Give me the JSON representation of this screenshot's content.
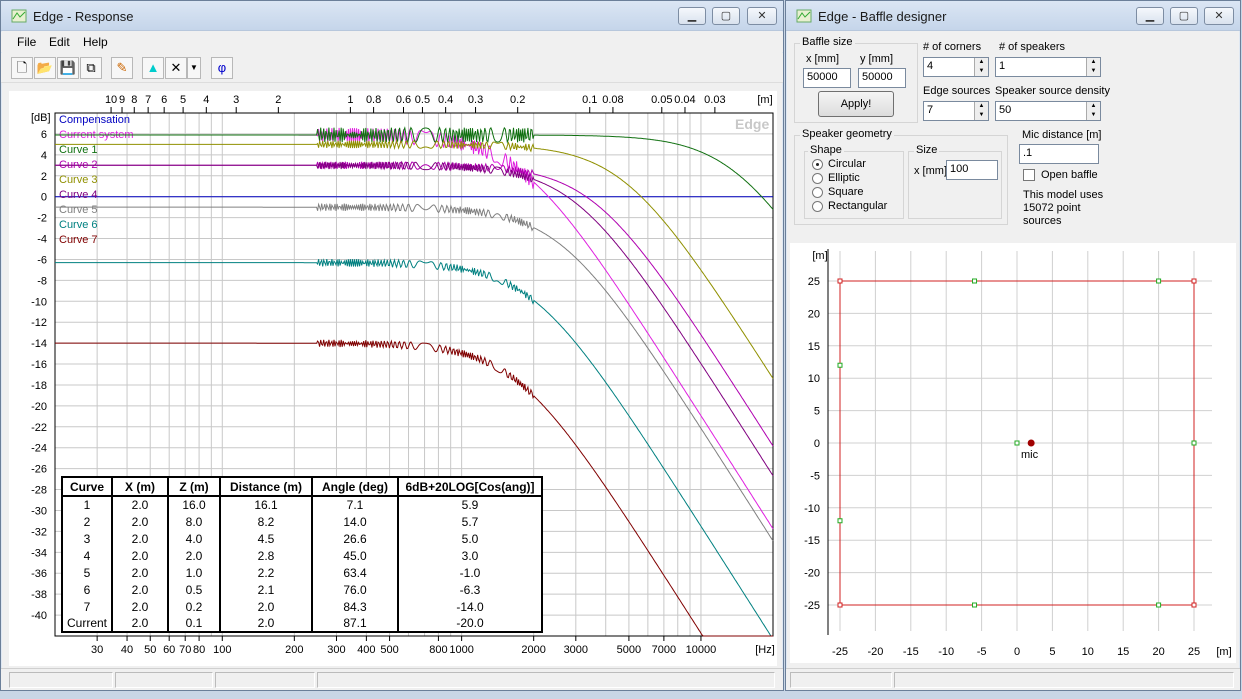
{
  "response_window": {
    "title": "Edge - Response",
    "menu": [
      "File",
      "Edit",
      "Help"
    ],
    "toolbar_icons": [
      "new-file-icon",
      "open-folder-icon",
      "save-icon",
      "copy-icon",
      "pen-icon",
      "bell-icon",
      "delete-x-icon",
      "dropdown-arrow-icon",
      "phi-icon"
    ],
    "phi_label": "φ",
    "watermark": "Edge",
    "chart_data": {
      "type": "line",
      "x_scale": "log",
      "x_unit": "[Hz]",
      "x_ticks": [
        "30",
        "40",
        "50",
        "60",
        "70",
        "80",
        "100",
        "200",
        "300",
        "400",
        "500",
        "800",
        "1000",
        "2000",
        "3000",
        "5000",
        "7000",
        "10000"
      ],
      "xlim": [
        20,
        20000
      ],
      "top_unit": "[m]",
      "top_ticks": [
        "10",
        "9",
        "8",
        "7",
        "6",
        "5",
        "4",
        "3",
        "2",
        "1",
        "0.8",
        "0.6",
        "0.5",
        "0.4",
        "0.3",
        "0.2",
        "0.1",
        "0.08",
        "0.05",
        "0.04",
        "0.03"
      ],
      "y_unit": "[dB]",
      "ylim": [
        -42,
        8
      ],
      "y_ticks": [
        6,
        4,
        2,
        0,
        -2,
        -4,
        -6,
        -8,
        -10,
        -12,
        -14,
        -16,
        -18,
        -20,
        -22,
        -24,
        -26,
        -28,
        -30,
        -32,
        -34,
        -36,
        -38,
        -40
      ],
      "grid": true,
      "legend_position": "top-left",
      "series": [
        {
          "name": "Compensation",
          "color": "#0000c0",
          "level_db": 0.0
        },
        {
          "name": "Current system",
          "color": "#e020e0",
          "level_db": 5.9
        },
        {
          "name": "Curve 1",
          "color": "#107010",
          "level_db": 5.9
        },
        {
          "name": "Curve 2",
          "color": "#b000b0",
          "level_db": 3.0
        },
        {
          "name": "Curve 3",
          "color": "#909000",
          "level_db": 5.0
        },
        {
          "name": "Curve 4",
          "color": "#800080",
          "level_db": 3.0
        },
        {
          "name": "Curve 5",
          "color": "#808080",
          "level_db": -1.0
        },
        {
          "name": "Curve 6",
          "color": "#008080",
          "level_db": -6.3
        },
        {
          "name": "Curve 7",
          "color": "#800000",
          "level_db": -14.0
        }
      ]
    },
    "table": {
      "headers": [
        "Curve",
        "X (m)",
        "Z (m)",
        "Distance (m)",
        "Angle (deg)",
        "6dB+20LOG[Cos(ang)]"
      ],
      "rows": [
        [
          "1",
          "2.0",
          "16.0",
          "16.1",
          "7.1",
          "5.9"
        ],
        [
          "2",
          "2.0",
          "8.0",
          "8.2",
          "14.0",
          "5.7"
        ],
        [
          "3",
          "2.0",
          "4.0",
          "4.5",
          "26.6",
          "5.0"
        ],
        [
          "4",
          "2.0",
          "2.0",
          "2.8",
          "45.0",
          "3.0"
        ],
        [
          "5",
          "2.0",
          "1.0",
          "2.2",
          "63.4",
          "-1.0"
        ],
        [
          "6",
          "2.0",
          "0.5",
          "2.1",
          "76.0",
          "-6.3"
        ],
        [
          "7",
          "2.0",
          "0.2",
          "2.0",
          "84.3",
          "-14.0"
        ],
        [
          "Current",
          "2.0",
          "0.1",
          "2.0",
          "87.1",
          "-20.0"
        ]
      ]
    }
  },
  "baffle_window": {
    "title": "Edge - Baffle designer",
    "baffle_size": {
      "group": "Baffle size",
      "x_label": "x [mm]",
      "y_label": "y [mm]",
      "x_value": "50000",
      "y_value": "50000",
      "apply": "Apply!"
    },
    "corners": {
      "label": "# of corners",
      "value": "4"
    },
    "speakers": {
      "label": "# of speakers",
      "value": "1"
    },
    "edge_sources": {
      "label": "Edge sources",
      "value": "7"
    },
    "density": {
      "label": "Speaker source density",
      "value": "50"
    },
    "geometry": {
      "group": "Speaker geometry",
      "shape_group": "Shape",
      "shapes": [
        "Circular",
        "Elliptic",
        "Square",
        "Rectangular"
      ],
      "selected": "Circular",
      "size_group": "Size",
      "size_label": "x [mm]",
      "size_value": "100"
    },
    "mic": {
      "label": "Mic distance [m]",
      "value": ".1",
      "open_baffle": "Open baffle",
      "open_baffle_checked": false
    },
    "model_note": "This model uses 15072 point sources",
    "plot": {
      "unit_y": "[m]",
      "unit_x": "[m]",
      "ticks": [
        25,
        20,
        15,
        10,
        5,
        0,
        -5,
        -10,
        -15,
        -20,
        -25
      ],
      "x_ticks_labels": [
        "-25",
        "-20",
        "-15",
        "-10",
        "-5",
        "0",
        "5",
        "10",
        "15",
        "20",
        "25"
      ],
      "baffle_color": "#d02020",
      "baffle_corners": [
        [
          -25,
          25
        ],
        [
          25,
          25
        ],
        [
          25,
          -25
        ],
        [
          -25,
          -25
        ]
      ],
      "edge_points": [
        [
          -6,
          25
        ],
        [
          20,
          25
        ],
        [
          -25,
          12
        ],
        [
          -25,
          -12
        ],
        [
          -6,
          -25
        ],
        [
          20,
          -25
        ],
        [
          25,
          0
        ],
        [
          0,
          0
        ]
      ],
      "mic_label": "mic",
      "speaker": [
        2,
        0
      ]
    }
  }
}
